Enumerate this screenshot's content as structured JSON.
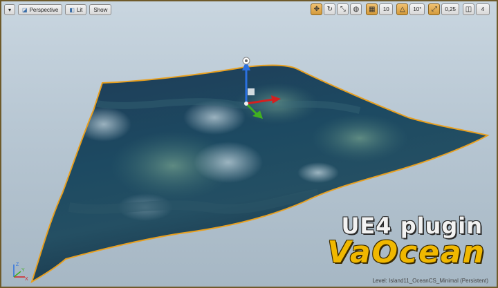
{
  "toolbar": {
    "menu_label": "▾",
    "perspective_label": "Perspective",
    "lit_label": "Lit",
    "show_label": "Show"
  },
  "snap": {
    "grid_value": "10",
    "rotation_value": "10°",
    "scale_value": "0,25",
    "camera_speed": "4"
  },
  "branding": {
    "line1": "UE4 plugin",
    "line2": "VaOcean"
  },
  "status": {
    "level_label": "Level:",
    "level_name": "Island11_OceanCS_Minimal (Persistent)"
  },
  "axis": {
    "x": "X",
    "y": "Y",
    "z": "Z"
  },
  "colors": {
    "selection_outline": "#e8a020",
    "gizmo_x": "#d42020",
    "gizmo_y": "#40b020",
    "gizmo_z": "#2a70e0",
    "title_yellow": "#f0b800"
  }
}
